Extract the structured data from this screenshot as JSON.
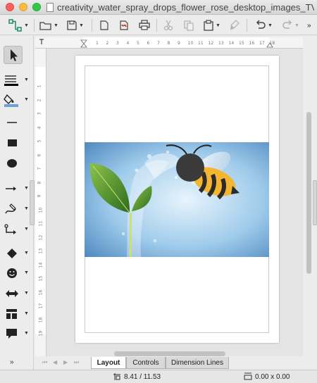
{
  "window": {
    "title": "creativity_water_spray_drops_flower_rose_desktop_images_TVld..."
  },
  "toolbar": {
    "tools": [
      "connector-tool",
      "open",
      "save",
      "export",
      "export-pdf",
      "print",
      "cut",
      "copy",
      "paste",
      "clone-formatting",
      "undo",
      "redo"
    ]
  },
  "sidebar": {
    "tools": [
      "select",
      "line-color",
      "fill-color",
      "line",
      "rectangle",
      "ellipse",
      "lines-arrows",
      "curves",
      "connectors",
      "basic-shapes",
      "symbol-shapes",
      "block-arrows",
      "flowchart",
      "callouts"
    ],
    "more_label": "»"
  },
  "ruler": {
    "h_numbers": [
      "1",
      "2",
      "3",
      "4",
      "5",
      "6",
      "7",
      "8",
      "9",
      "10",
      "11",
      "12",
      "13",
      "14",
      "15",
      "16",
      "17",
      "18"
    ],
    "v_numbers": [
      "1",
      "2",
      "3",
      "4",
      "5",
      "6",
      "7",
      "8",
      "9",
      "10",
      "11",
      "12",
      "13",
      "14",
      "15",
      "16",
      "17",
      "18",
      "19"
    ]
  },
  "tabs": [
    {
      "label": "Layout",
      "active": true
    },
    {
      "label": "Controls",
      "active": false
    },
    {
      "label": "Dimension Lines",
      "active": false
    }
  ],
  "status": {
    "position": "8.41 / 11.53",
    "size": "0.00 x 0.00"
  },
  "colors": {
    "fill_swatch": "#729fcf",
    "line_swatch": "#000000",
    "picture_bg": "#5b95c8"
  }
}
